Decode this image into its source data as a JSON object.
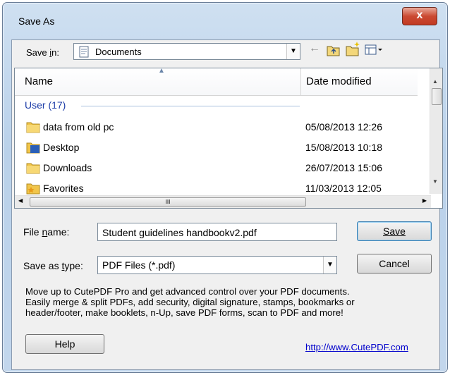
{
  "window": {
    "title": "Save As",
    "close_glyph": "x"
  },
  "save_in": {
    "label_prefix": "Save ",
    "label_underlined": "i",
    "label_suffix": "n:",
    "value": "Documents"
  },
  "toolbar": {
    "back_icon": "back-arrow-icon",
    "up_icon": "up-folder-icon",
    "new_folder_icon": "new-folder-icon",
    "views_icon": "views-menu-icon"
  },
  "file_list": {
    "columns": [
      "Name",
      "Date modified"
    ],
    "group": "User (17)",
    "rows": [
      {
        "name": "data from old pc",
        "date": "05/08/2013 12:26",
        "icon": "folder-icon"
      },
      {
        "name": "Desktop",
        "date": "15/08/2013 10:18",
        "icon": "desktop-folder-icon"
      },
      {
        "name": "Downloads",
        "date": "26/07/2013 15:06",
        "icon": "folder-icon"
      },
      {
        "name": "Favorites",
        "date": "11/03/2013 12:05",
        "icon": "favorites-folder-icon"
      }
    ],
    "hscroll_grip": "III"
  },
  "file_name": {
    "label_prefix": "File ",
    "label_underlined": "n",
    "label_suffix": "ame:",
    "value": "Student guidelines handbookv2.pdf"
  },
  "save_type": {
    "label_prefix": "Save as ",
    "label_underlined": "t",
    "label_suffix": "ype:",
    "value": "PDF Files (*.pdf)"
  },
  "buttons": {
    "save": "Save",
    "cancel": "Cancel",
    "help": "Help"
  },
  "promo": {
    "line1": "Move up to CutePDF Pro and get advanced control over your PDF documents.",
    "line2": "Easily merge & split PDFs, add security, digital signature, stamps, bookmarks or",
    "line3": "header/footer, make booklets, n-Up, save PDF forms, scan to PDF and more!"
  },
  "link": "http://www.CutePDF.com",
  "colors": {
    "group_text": "#1e3ea8",
    "link": "#0000cc",
    "frame": "#b9d1ea",
    "close": "#c23a22"
  }
}
